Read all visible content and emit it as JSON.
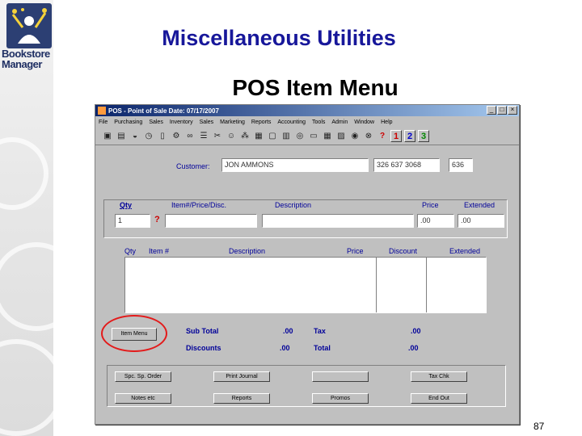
{
  "slide": {
    "title": "Miscellaneous Utilities",
    "subtitle": "POS Item Menu",
    "page_number": "87"
  },
  "logo": {
    "line1": "Bookstore",
    "line2": "Manager"
  },
  "window": {
    "title": "POS - Point of Sale  Date: 07/17/2007",
    "menu": [
      "File",
      "Purchasing",
      "Sales",
      "Inventory",
      "Sales",
      "Marketing",
      "Reports",
      "Accounting",
      "Tools",
      "Admin",
      "Window",
      "Help"
    ],
    "toolbar_numbers": [
      "1",
      "2",
      "3"
    ],
    "customer": {
      "label": "Customer:",
      "name": "JON AMMONS",
      "phone": "326 637 3068",
      "code": "636"
    },
    "entry": {
      "headers": {
        "qty": "Qty",
        "item": "Item#/Price/Disc.",
        "description": "Description",
        "price": "Price",
        "extended": "Extended"
      },
      "qty_value": "1",
      "item_value": "",
      "description_value": "",
      "price_value": ".00",
      "extended_value": ".00",
      "lookup_symbol": "?"
    },
    "lines": {
      "headers": {
        "qty": "Qty",
        "item": "Item #",
        "description": "Description",
        "price": "Price",
        "discount": "Discount",
        "extended": "Extended"
      }
    },
    "item_menu_button": "Item Menu",
    "totals": {
      "subtotal_label": "Sub Total",
      "subtotal_value": ".00",
      "tax_label": "Tax",
      "tax_value": ".00",
      "discounts_label": "Discounts",
      "discounts_value": ".00",
      "total_label": "Total",
      "total_value": ".00"
    },
    "buttons": {
      "special_order": "Spc. Sp. Order",
      "print_journal": "Print Journal",
      "blank": "",
      "tax_chk": "Tax Chk",
      "notes": "Notes etc",
      "reports": "Reports",
      "promos": "Promos",
      "end_out": "End Out"
    }
  },
  "colors": {
    "title_blue": "#17179a",
    "label_blue": "#000099",
    "annotation_red": "#e31a1a",
    "window_gray": "#c0c0c0"
  }
}
